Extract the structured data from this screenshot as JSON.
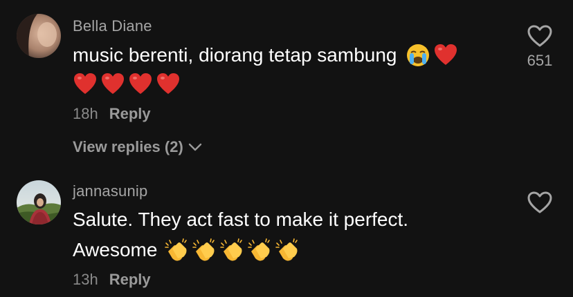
{
  "comments": [
    {
      "username": "Bella Diane",
      "text_line_1": "music berenti, diorang tetap sambung",
      "line_1_emojis": [
        "crying-face",
        "red-heart"
      ],
      "line_2_emojis": [
        "red-heart",
        "red-heart",
        "red-heart",
        "red-heart"
      ],
      "time": "18h",
      "reply_label": "Reply",
      "view_replies_label": "View replies (2)",
      "like_count": "651"
    },
    {
      "username": "jannasunip",
      "text_line_1": "Salute. They act fast to make it perfect.",
      "text_line_2": "Awesome",
      "line_2_emojis": [
        "clapping-hands",
        "clapping-hands",
        "clapping-hands",
        "clapping-hands",
        "clapping-hands"
      ],
      "time": "13h",
      "reply_label": "Reply"
    }
  ],
  "colors": {
    "background": "#121212",
    "username": "#a5a5a5",
    "text": "#ffffff",
    "meta": "#8a8a8a",
    "heart_emoji": "#e0312e"
  }
}
